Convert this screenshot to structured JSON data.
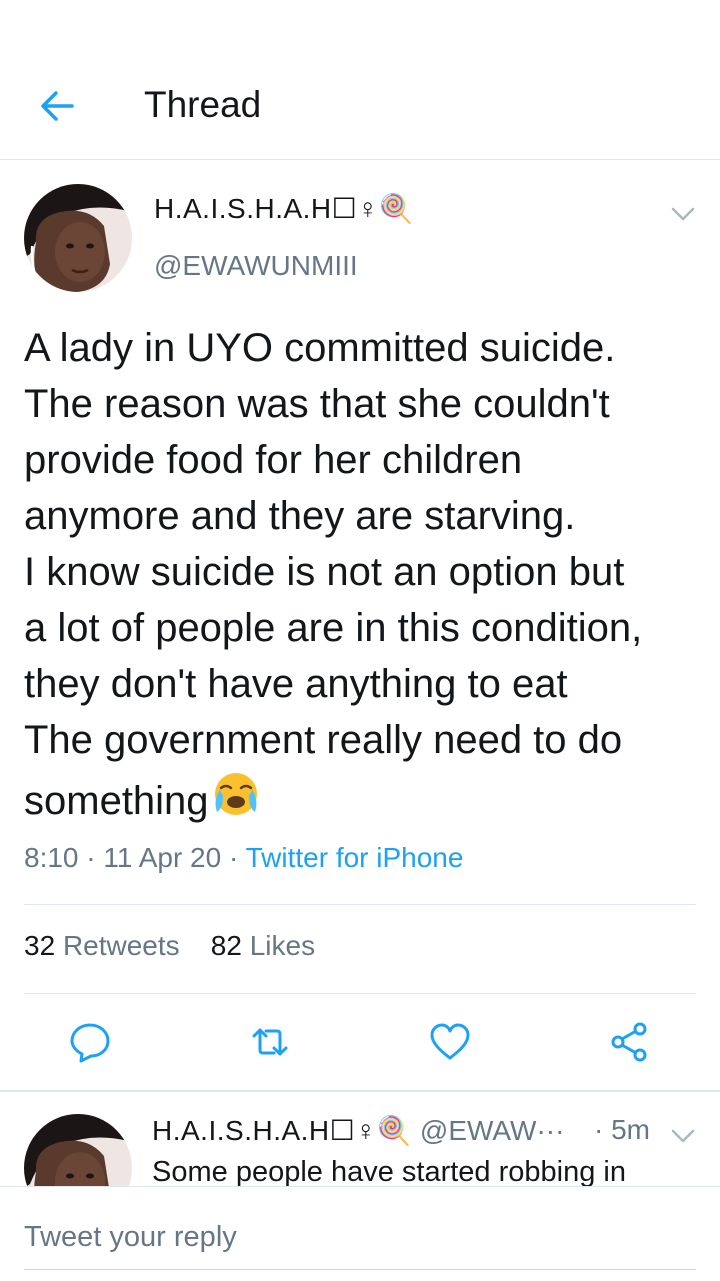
{
  "header": {
    "title": "Thread"
  },
  "tweet": {
    "display_name": "H.A.I.S.H.A.H☐♀🍭",
    "handle": "@EWAWUNMIII",
    "text_lines": [
      "A lady in UYO committed suicide.",
      "The reason was that she couldn't",
      "provide food for her children",
      "anymore and they are starving.",
      "I know suicide is not an option but",
      "a lot of people are in this condition,",
      "they don't have anything to eat",
      "The government really need to do",
      "something"
    ],
    "time": "8:10",
    "date": "11 Apr 20",
    "source": "Twitter for iPhone",
    "retweets_count": "32",
    "retweets_label": "Retweets",
    "likes_count": "82",
    "likes_label": "Likes"
  },
  "reply": {
    "display_name": "H.A.I.S.H.A.H☐♀🍭",
    "handle": "@EWAW···",
    "time": "5m",
    "text": "Some people have started robbing in"
  },
  "compose": {
    "placeholder": "Tweet your reply"
  },
  "colors": {
    "accent": "#1da1f2",
    "secondary_text": "#657786",
    "divider": "#e1e8ed"
  },
  "icons": [
    "back-arrow-icon",
    "chevron-down-icon",
    "reply-icon",
    "retweet-icon",
    "like-icon",
    "share-icon",
    "crying-face-emoji"
  ]
}
